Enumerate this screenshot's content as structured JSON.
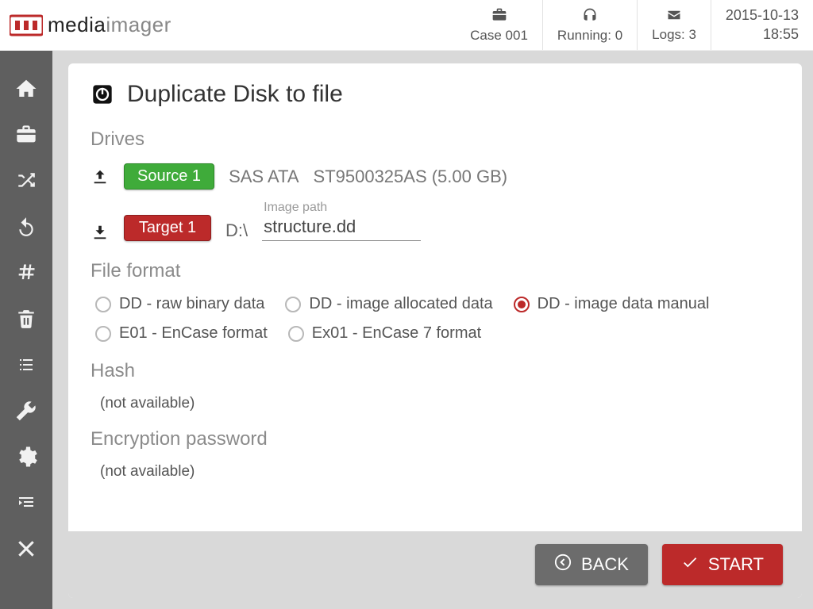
{
  "brand": {
    "part1": "media",
    "part2": "imager"
  },
  "header": {
    "case": {
      "label": "Case 001"
    },
    "running": {
      "label": "Running: 0"
    },
    "logs": {
      "label": "Logs: 3"
    },
    "date": "2015-10-13",
    "time": "18:55"
  },
  "page": {
    "title": "Duplicate Disk to file",
    "sections": {
      "drives": {
        "heading": "Drives",
        "source": {
          "badge": "Source 1",
          "bus": "SAS ATA",
          "model": "ST9500325AS (5.00 GB)"
        },
        "target": {
          "badge": "Target 1",
          "path": "D:\\",
          "image_path_label": "Image path",
          "image_path_value": "structure.dd"
        }
      },
      "file_format": {
        "heading": "File format",
        "options": [
          {
            "label": "DD - raw binary data",
            "selected": false
          },
          {
            "label": "DD - image allocated data",
            "selected": false
          },
          {
            "label": "DD - image data manual",
            "selected": true
          },
          {
            "label": "E01 - EnCase format",
            "selected": false
          },
          {
            "label": "Ex01 - EnCase 7 format",
            "selected": false
          }
        ]
      },
      "hash": {
        "heading": "Hash",
        "value": "(not available)"
      },
      "encryption": {
        "heading": "Encryption password",
        "value": "(not available)"
      }
    }
  },
  "actions": {
    "back": "BACK",
    "start": "START"
  }
}
